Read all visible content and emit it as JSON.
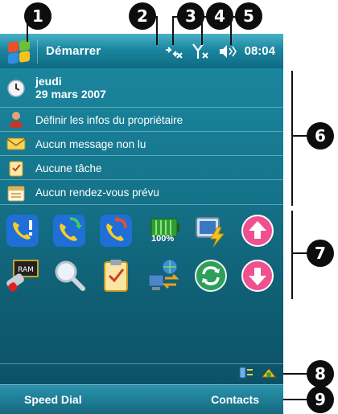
{
  "titlebar": {
    "start_label": "Démarrer",
    "time": "08:04",
    "icons": [
      "windows-start-icon",
      "connectivity-icon",
      "signal-off-icon",
      "volume-muted-icon"
    ]
  },
  "today": {
    "day": "jeudi",
    "date": "29 mars 2007",
    "owner": "Définir les infos du propriétaire",
    "messages": "Aucun message non lu",
    "tasks": "Aucune tâche",
    "appointments": "Aucun rendez-vous prévu"
  },
  "launcher": {
    "battery_label": "100%",
    "icons_row1": [
      "phone-alert-icon",
      "phone-transfer-icon",
      "phone-callback-icon",
      "battery-icon",
      "power-screen-icon",
      "arrow-up-icon"
    ],
    "icons_row2": [
      "ram-icon",
      "magnifier-icon",
      "clipboard-icon",
      "network-sync-icon",
      "refresh-icon",
      "arrow-down-icon"
    ]
  },
  "softkeys": {
    "left": "Speed Dial",
    "right": "Contacts"
  },
  "callouts": {
    "c1": "1",
    "c2": "2",
    "c3": "3",
    "c4": "4",
    "c5": "5",
    "c6": "6",
    "c7": "7",
    "c8": "8",
    "c9": "9"
  },
  "colors": {
    "screen": "#16788f",
    "softkey_bar": "#1f7e97",
    "callout": "#0d0d0d"
  }
}
